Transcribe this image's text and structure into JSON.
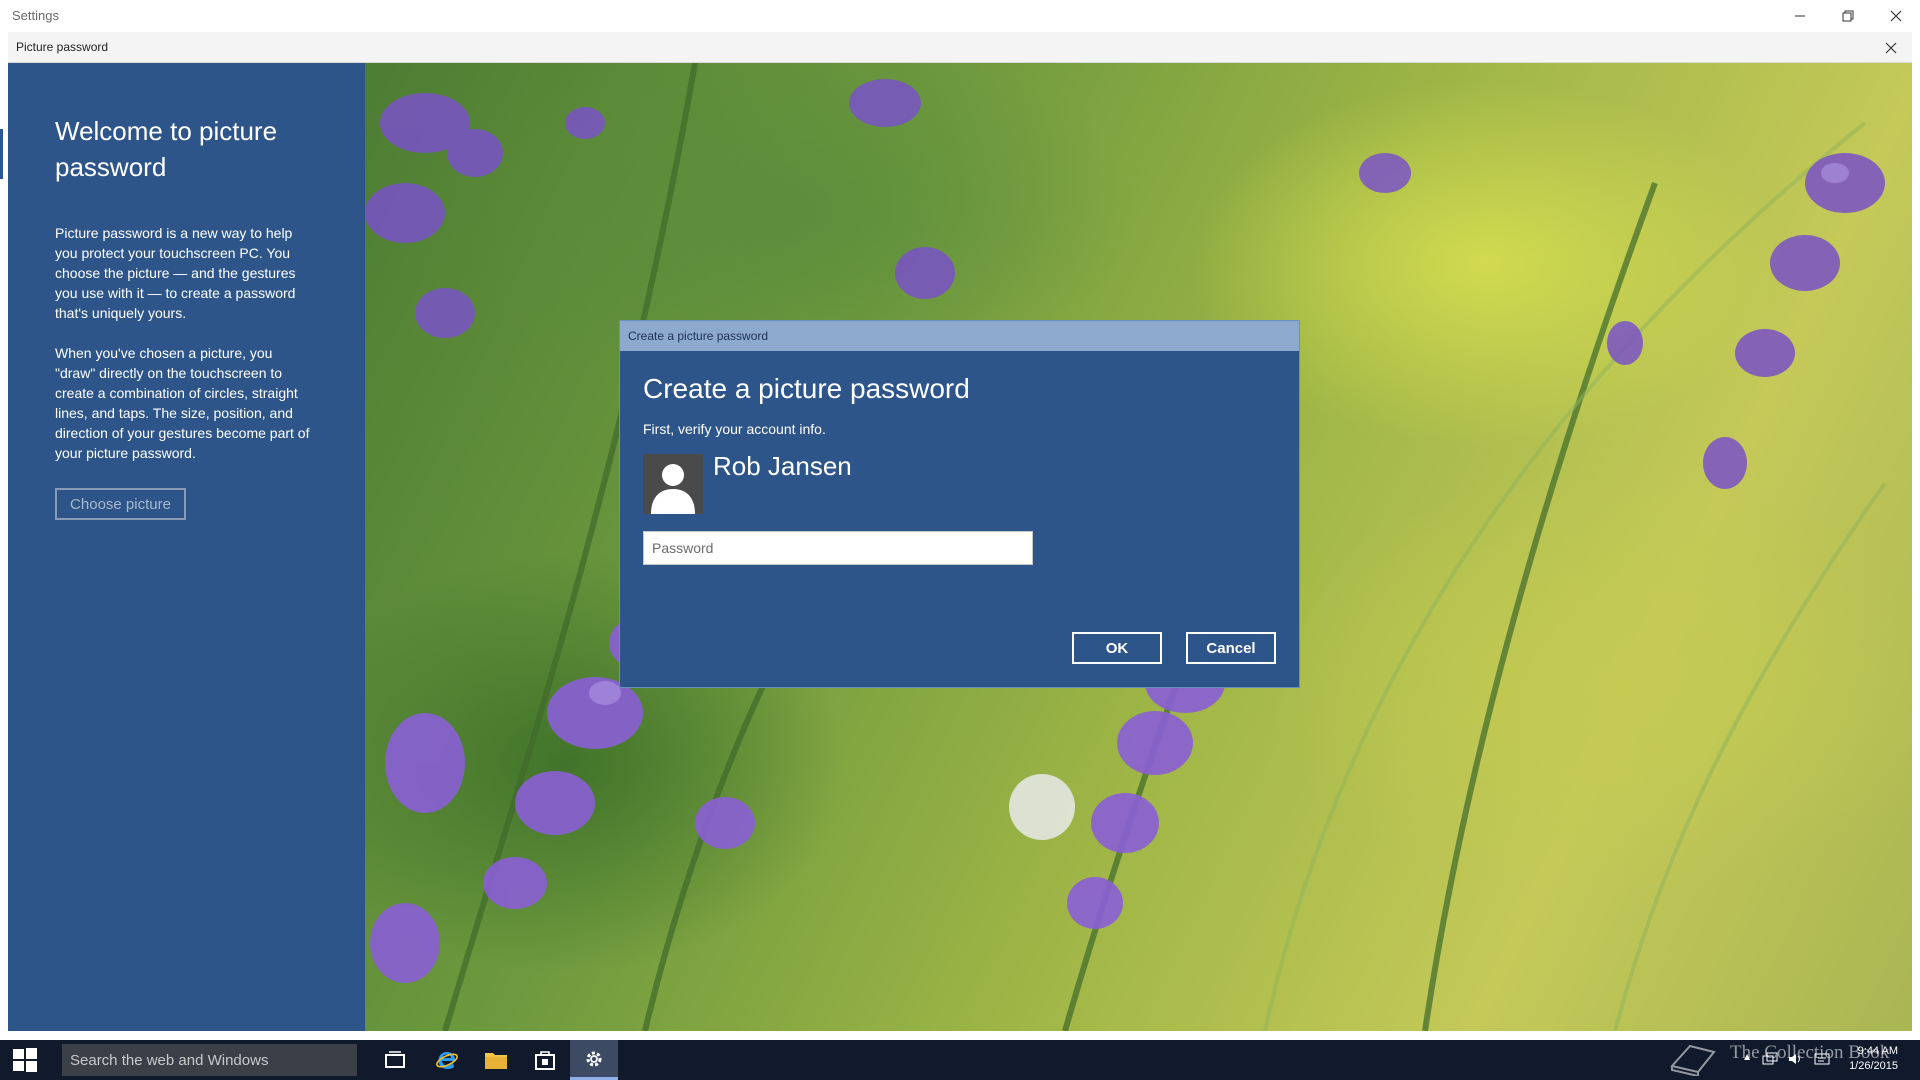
{
  "window": {
    "title": "Settings"
  },
  "subwindow": {
    "title": "Picture password"
  },
  "panel": {
    "heading": "Welcome to picture password",
    "para1": "Picture password is a new way to help you protect your touchscreen PC. You choose the picture — and the gestures you use with it — to create a password that's uniquely yours.",
    "para2": "When you've chosen a picture, you \"draw\" directly on the touchscreen to create a combination of circles, straight lines, and taps. The size, position, and direction of your gestures become part of your picture password.",
    "choose_label": "Choose picture"
  },
  "dialog": {
    "window_title": "Create a picture password",
    "heading": "Create a picture password",
    "subtitle": "First, verify your account info.",
    "username": "Rob Jansen",
    "password_placeholder": "Password",
    "ok_label": "OK",
    "cancel_label": "Cancel"
  },
  "taskbar": {
    "search_placeholder": "Search the web and Windows",
    "watermark": "The Collection Book",
    "time": "9:44 AM",
    "date": "1/26/2015"
  },
  "colors": {
    "panel_blue": "#2d5589",
    "dialog_title": "#8da9ce",
    "taskbar": "#101a2c"
  }
}
